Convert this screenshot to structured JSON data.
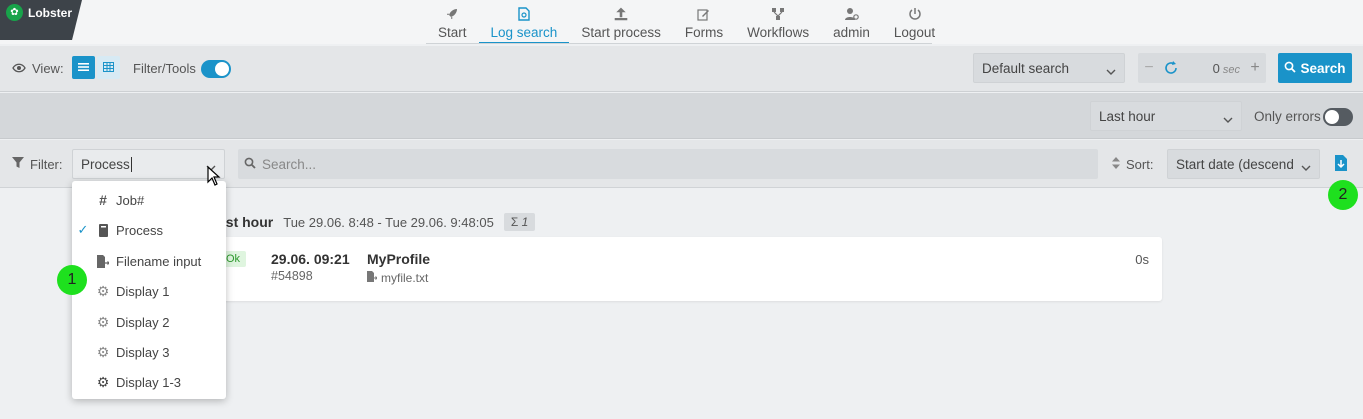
{
  "app": {
    "logo": "Lobster"
  },
  "nav": [
    {
      "label": "Start",
      "icon": "rocket-icon"
    },
    {
      "label": "Log search",
      "icon": "log-search-icon",
      "active": true
    },
    {
      "label": "Start process",
      "icon": "upload-icon"
    },
    {
      "label": "Forms",
      "icon": "edit-icon"
    },
    {
      "label": "Workflows",
      "icon": "workflow-icon"
    },
    {
      "label": "admin",
      "icon": "user-gear-icon"
    },
    {
      "label": "Logout",
      "icon": "power-icon"
    }
  ],
  "toolbar": {
    "view_label": "View:",
    "filter_tools_label": "Filter/Tools",
    "filter_tools_on": true,
    "default_search": "Default search",
    "refresh_seconds": "0",
    "refresh_unit": "sec",
    "search_button": "Search"
  },
  "timeframe": {
    "selected": "Last hour",
    "only_errors_label": "Only errors",
    "only_errors_on": false
  },
  "filterbar": {
    "filter_label": "Filter:",
    "filter_field": "Process",
    "search_placeholder": "Search...",
    "sort_label": "Sort:",
    "sort_value": "Start date (descending)"
  },
  "dropdown": {
    "items": [
      {
        "label": "Job#",
        "icon": "hash-icon",
        "checked": false
      },
      {
        "label": "Process",
        "icon": "process-icon",
        "checked": true
      },
      {
        "label": "Filename input",
        "icon": "file-input-icon",
        "checked": false
      },
      {
        "label": "Display 1",
        "icon": "gear-icon",
        "checked": false
      },
      {
        "label": "Display 2",
        "icon": "gear-icon",
        "checked": false
      },
      {
        "label": "Display 3",
        "icon": "gear-icon",
        "checked": false
      },
      {
        "label": "Display 1-3",
        "icon": "gears-icon",
        "checked": false
      }
    ]
  },
  "results": {
    "title_visible": "ast hour",
    "range": "Tue 29.06. 8:48 - Tue 29.06. 9:48:05",
    "count_symbol": "Σ",
    "count": "1",
    "rows": [
      {
        "status": "Ok",
        "time": "29.06. 09:21",
        "job": "#54898",
        "profile": "MyProfile",
        "filename": "myfile.txt",
        "duration": "0s"
      }
    ]
  },
  "markers": [
    "1",
    "2"
  ],
  "colors": {
    "accent": "#1a93c9",
    "marker": "#1ee01e",
    "logo_bg": "#3d4349"
  }
}
